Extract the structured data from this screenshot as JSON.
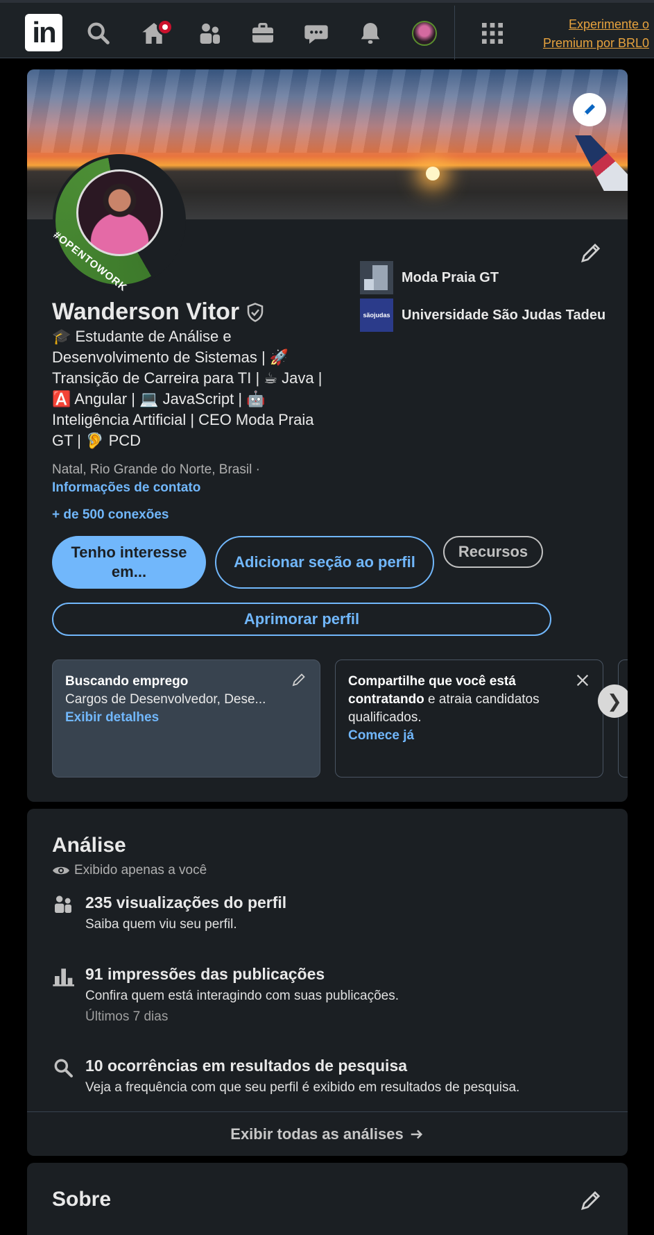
{
  "nav": {
    "logo_text": "in",
    "premium_line1": "Experimente o",
    "premium_line2": "Premium por BRL0"
  },
  "profile": {
    "name": "Wanderson Vitor",
    "headline": "🎓 Estudante de Análise e Desenvolvimento de Sistemas | 🚀 Transição de Carreira para TI | ☕ Java | 🅰️ Angular | 💻 JavaScript | 🤖 Inteligência Artificial | CEO Moda Praia GT | 🦻 PCD",
    "open_to_work_frame": "#OPENTOWORK",
    "location": "Natal, Rio Grande do Norte, Brasil ·",
    "contact_link": "Informações de contato",
    "connections": "+ de 500 conexões",
    "orgs": [
      {
        "name": "Moda Praia GT"
      },
      {
        "name": "Universidade São Judas Tadeu",
        "logo_text": "sãojudas"
      }
    ],
    "buttons": {
      "open_to": "Tenho interesse em...",
      "add_section": "Adicionar seção ao perfil",
      "resources": "Recursos",
      "enhance": "Aprimorar perfil"
    },
    "tiles": {
      "job_title": "Buscando emprego",
      "job_desc": "Cargos de Desenvolvedor, Dese...",
      "job_link": "Exibir detalhes",
      "hire_bold": "Compartilhe que você está contratando",
      "hire_rest": " e atraia candidatos qualificados.",
      "hire_link": "Comece já"
    }
  },
  "analytics": {
    "title": "Análise",
    "private_note": "Exibido apenas a você",
    "metrics": [
      {
        "title": "235 visualizações do perfil",
        "desc": "Saiba quem viu seu perfil.",
        "icon": "people-icon"
      },
      {
        "title": "91 impressões das publicações",
        "desc": "Confira quem está interagindo com suas publicações.",
        "sub": "Últimos 7 dias",
        "icon": "bar-chart-icon"
      },
      {
        "title": "10 ocorrências em resultados de pesquisa",
        "desc": "Veja a frequência com que seu perfil é exibido em resultados de pesquisa.",
        "icon": "search-icon"
      }
    ],
    "footer": "Exibir todas as análises"
  },
  "about": {
    "title": "Sobre"
  },
  "colors": {
    "accent": "#71b7fb",
    "background": "#000000",
    "card": "#1b1f23",
    "premium": "#e7a33e",
    "open_to_work": "#4d8f36"
  }
}
